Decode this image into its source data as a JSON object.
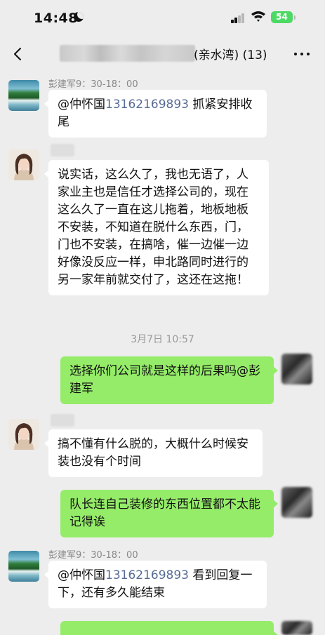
{
  "status_bar": {
    "time": "14:48",
    "battery": "54"
  },
  "header": {
    "title": "(亲水湾) (13)"
  },
  "messages": [
    {
      "sender": "彭建军9：30-18：00",
      "mention": "@仲怀国",
      "phone": "13162169893",
      "text": " 抓紧安排收尾"
    },
    {
      "text": "说实话，这么久了，我也无语了，人家业主也是信任才选择公司的，现在这么久了一直在这儿拖着，地板地板不安装，不知道在脱什么东西，门，门也不安装，在搞啥，催一边催一边好像没反应一样，申北路同时进行的另一家年前就交付了，这还在这拖！"
    },
    {
      "text": "选择你们公司就是这样的后果吗@彭建军"
    },
    {
      "text": "搞不懂有什么脱的，大概什么时候安装也没有个时间"
    },
    {
      "text": "队长连自己装修的东西位置都不太能记得诶"
    },
    {
      "sender": "彭建军9：30-18：00",
      "mention": "@仲怀国",
      "phone": "13162169893",
      "text": " 看到回复一下，还有多久能结束"
    }
  ],
  "timestamp": "3月7日 10:57",
  "icons": {
    "back": "chevron-left-icon",
    "more": "more-dots-icon",
    "signal": "cellular-signal-icon",
    "wifi": "wifi-icon",
    "battery": "battery-icon",
    "moon": "moon-icon"
  },
  "colors": {
    "background": "#ededed",
    "incoming_bubble": "#ffffff",
    "outgoing_bubble": "#95ec69",
    "link": "#576b95",
    "battery": "#4cd964"
  }
}
